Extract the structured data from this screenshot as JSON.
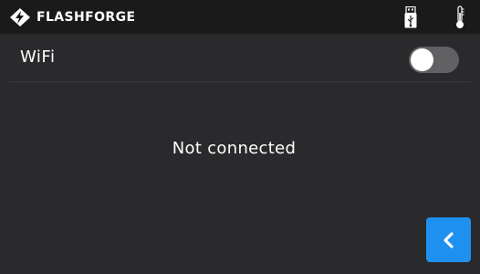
{
  "header": {
    "brand_name": "FLASHFORGE",
    "icons": {
      "logo": "flashforge-logo-icon",
      "usb": "usb-drive-icon",
      "temperature": "thermometer-icon"
    }
  },
  "wifi": {
    "label": "WiFi",
    "toggle_state": "off"
  },
  "status": {
    "text": "Not connected"
  },
  "back_button": {
    "icon": "chevron-left-icon"
  },
  "colors": {
    "background": "#2a2a2c",
    "topbar": "#1a1a1b",
    "accent": "#1e90f0",
    "toggle_track": "#616163"
  }
}
